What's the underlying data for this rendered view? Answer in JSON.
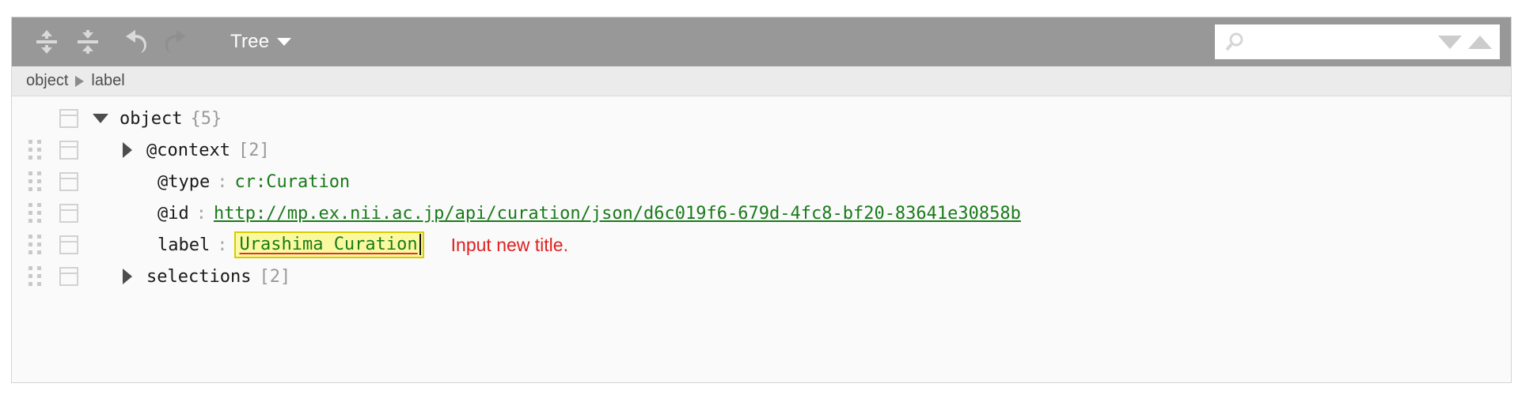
{
  "toolbar": {
    "expand_all_label": "Expand all",
    "collapse_all_label": "Collapse all",
    "undo_label": "Undo",
    "redo_label": "Redo",
    "mode_label": "Tree"
  },
  "search": {
    "value": "",
    "placeholder": "",
    "icon": "search-icon",
    "next_label": "Next",
    "previous_label": "Previous"
  },
  "breadcrumb": {
    "items": [
      "object",
      "label"
    ],
    "separator": "▶"
  },
  "tree": {
    "rows": [
      {
        "key": "object",
        "count": "{5}",
        "expander": "open",
        "has_drag": false,
        "indent": 0,
        "value": "",
        "value_type": "none"
      },
      {
        "key": "@context",
        "count": "[2]",
        "expander": "closed",
        "has_drag": true,
        "indent": 1,
        "value": "",
        "value_type": "none"
      },
      {
        "key": "@type",
        "count": "",
        "expander": "none",
        "has_drag": true,
        "indent": 1,
        "value": "cr:Curation",
        "value_type": "green"
      },
      {
        "key": "@id",
        "count": "",
        "expander": "none",
        "has_drag": true,
        "indent": 1,
        "value": "http://mp.ex.nii.ac.jp/api/curation/json/d6c019f6-679d-4fc8-bf20-83641e30858b",
        "value_type": "link"
      },
      {
        "key": "label",
        "count": "",
        "expander": "none",
        "has_drag": true,
        "indent": 1,
        "value": "Urashima Curation",
        "value_type": "editing",
        "annotation": "Input new title."
      },
      {
        "key": "selections",
        "count": "[2]",
        "expander": "closed",
        "has_drag": true,
        "indent": 1,
        "value": "",
        "value_type": "none"
      }
    ],
    "colon": ":"
  },
  "colors": {
    "toolbar_bg": "#989898",
    "breadcrumb_bg": "#ebebeb",
    "body_bg": "#fafafa",
    "value_green": "#1a7a1a",
    "highlight_yellow": "#fbf9a0",
    "highlight_border": "#d8cc00",
    "annotation_red": "#e02020",
    "spellcheck_red": "#e03030"
  }
}
